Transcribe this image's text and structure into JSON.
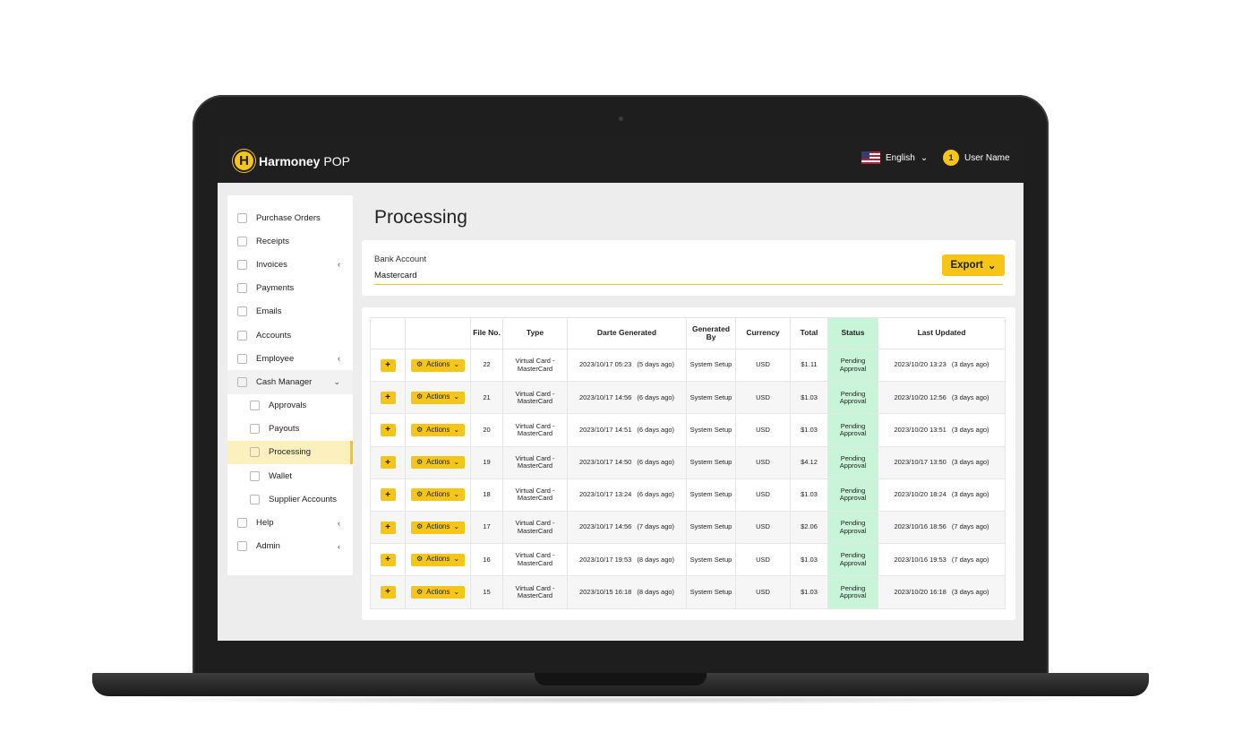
{
  "app": {
    "logo_letter": "H",
    "logo_name": "Harmoney",
    "logo_suffix": "POP",
    "language": "English",
    "notification_count": "1",
    "user_name": "User Name"
  },
  "sidebar": {
    "items": [
      {
        "label": "Purchase Orders",
        "icon": "clipboard-icon",
        "caret": ""
      },
      {
        "label": "Receipts",
        "icon": "receipt-icon",
        "caret": ""
      },
      {
        "label": "Invoices",
        "icon": "invoice-icon",
        "caret": "‹"
      },
      {
        "label": "Payments",
        "icon": "payments-icon",
        "caret": ""
      },
      {
        "label": "Emails",
        "icon": "email-icon",
        "caret": ""
      },
      {
        "label": "Accounts",
        "icon": "accounts-icon",
        "caret": ""
      },
      {
        "label": "Employee",
        "icon": "employee-icon",
        "caret": "‹"
      },
      {
        "label": "Cash Manager",
        "icon": "cash-icon",
        "caret": "⌄"
      },
      {
        "label": "Approvals",
        "icon": "check-icon",
        "caret": ""
      },
      {
        "label": "Payouts",
        "icon": "payouts-icon",
        "caret": ""
      },
      {
        "label": "Processing",
        "icon": "processing-icon",
        "caret": ""
      },
      {
        "label": "Wallet",
        "icon": "wallet-icon",
        "caret": ""
      },
      {
        "label": "Supplier Accounts",
        "icon": "supplier-icon",
        "caret": ""
      },
      {
        "label": "Help",
        "icon": "help-icon",
        "caret": "‹"
      },
      {
        "label": "Admin",
        "icon": "wrench-icon",
        "caret": "‹"
      }
    ]
  },
  "main": {
    "title": "Processing",
    "filter": {
      "label": "Bank Account",
      "value": "Mastercard"
    },
    "export_label": "Export"
  },
  "table": {
    "headers": [
      "File No.",
      "Type",
      "Darte Generated",
      "Generated By",
      "Currency",
      "Total",
      "Status",
      "Last Updated"
    ],
    "plus_label": "+",
    "actions_label": "Actions",
    "rows": [
      {
        "file": "22",
        "type": "Virtual Card - MasterCard",
        "gen_date": "2023/10/17 05:23",
        "gen_ago": "(5 days ago)",
        "by": "System Setup",
        "currency": "USD",
        "total": "$1.11",
        "status": "Pending Approval",
        "upd_date": "2023/10/20 13:23",
        "upd_ago": "(3 days ago)"
      },
      {
        "file": "21",
        "type": "Virtual Card - MasterCard",
        "gen_date": "2023/10/17 14:56",
        "gen_ago": "(6 days ago)",
        "by": "System Setup",
        "currency": "USD",
        "total": "$1.03",
        "status": "Pending Approval",
        "upd_date": "2023/10/20 12:56",
        "upd_ago": "(3 days ago)"
      },
      {
        "file": "20",
        "type": "Virtual Card - MasterCard",
        "gen_date": "2023/10/17 14:51",
        "gen_ago": "(6 days ago)",
        "by": "System Setup",
        "currency": "USD",
        "total": "$1.03",
        "status": "Pending Approval",
        "upd_date": "2023/10/20 13:51",
        "upd_ago": "(3 days ago)"
      },
      {
        "file": "19",
        "type": "Virtual Card - MasterCard",
        "gen_date": "2023/10/17 14:50",
        "gen_ago": "(6 days ago)",
        "by": "System Setup",
        "currency": "USD",
        "total": "$4.12",
        "status": "Pending Approval",
        "upd_date": "2023/10/17 13:50",
        "upd_ago": "(3 days ago)"
      },
      {
        "file": "18",
        "type": "Virtual Card - MasterCard",
        "gen_date": "2023/10/17 13:24",
        "gen_ago": "(6 days ago)",
        "by": "System Setup",
        "currency": "USD",
        "total": "$1.03",
        "status": "Pending Approval",
        "upd_date": "2023/10/20 18:24",
        "upd_ago": "(3 days ago)"
      },
      {
        "file": "17",
        "type": "Virtual Card - MasterCard",
        "gen_date": "2023/10/17 14:56",
        "gen_ago": "(7 days ago)",
        "by": "System Setup",
        "currency": "USD",
        "total": "$2.06",
        "status": "Pending Approval",
        "upd_date": "2023/10/16 18:56",
        "upd_ago": "(7 days ago)"
      },
      {
        "file": "16",
        "type": "Virtual Card - MasterCard",
        "gen_date": "2023/10/17 19:53",
        "gen_ago": "(8 days ago)",
        "by": "System Setup",
        "currency": "USD",
        "total": "$1.03",
        "status": "Pending Approval",
        "upd_date": "2023/10/16 19:53",
        "upd_ago": "(7 days ago)"
      },
      {
        "file": "15",
        "type": "Virtual Card - MasterCard",
        "gen_date": "2023/10/15 16:18",
        "gen_ago": "(8 days ago)",
        "by": "System Setup",
        "currency": "USD",
        "total": "$1.03",
        "status": "Pending Approval",
        "upd_date": "2023/10/20 16:18",
        "upd_ago": "(3 days ago)"
      }
    ]
  },
  "colors": {
    "accent": "#f5c518",
    "topbar": "#1f1f1f",
    "status_bg": "#c8f5d8",
    "active_nav": "#fdf0bf"
  }
}
